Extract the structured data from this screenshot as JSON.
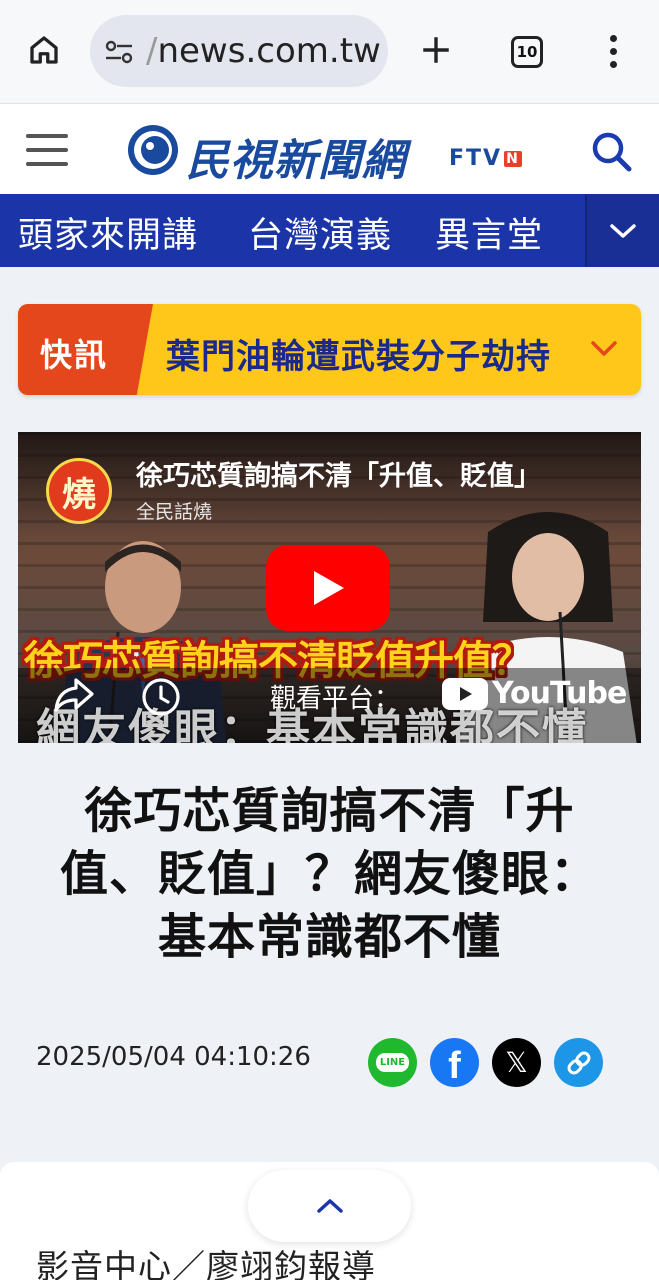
{
  "browser": {
    "url_prefix": "/",
    "url": "news.com.tw",
    "tab_count": "10"
  },
  "site": {
    "logo_text": "民視新聞網",
    "logo_sub": "FTV",
    "logo_badge": "N",
    "brand_color": "#1a4a9e"
  },
  "nav": {
    "items": [
      "頭家來開講",
      "台灣演義",
      "異言堂"
    ],
    "bar_color": "#1b35a8"
  },
  "breaking": {
    "tag": "快訊",
    "text": "葉門油輪遭武裝分子劫持",
    "tag_color": "#e4471c",
    "bg_color": "#ffc71a"
  },
  "video": {
    "title": "徐巧芯質詢搞不清「升值、貶值」",
    "channel": "全民話燒",
    "channel_icon_char": "燒",
    "caption_top": "徐巧芯質詢搞不清貶值升值？",
    "caption_bottom": "網友傻眼：基本常識都不懂",
    "watch_label": "觀看平台：",
    "platform": "YouTube"
  },
  "article": {
    "headline_line1": "徐巧芯質詢搞不清「升",
    "headline_line2": "值、貶值」？網友傻眼：",
    "headline_line3": "基本常識都不懂",
    "date": "2025/05/04 04:10:26",
    "byline": "影音中心／廖翊鈞報導"
  },
  "share": {
    "line_label": "LINE",
    "fb_label": "f",
    "x_label": "𝕏"
  }
}
